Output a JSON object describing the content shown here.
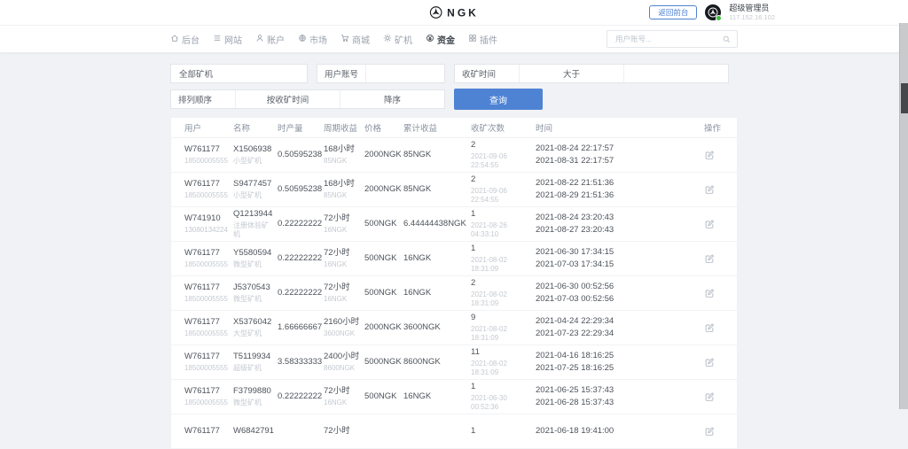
{
  "header": {
    "logo_text": "NGK",
    "back_button_label": "返回前台",
    "admin_name": "超级管理员",
    "admin_ip": "117.152.16.102"
  },
  "nav": {
    "items": [
      {
        "label": "后台",
        "icon": "home"
      },
      {
        "label": "网站",
        "icon": "list"
      },
      {
        "label": "账户",
        "icon": "user"
      },
      {
        "label": "市场",
        "icon": "globe"
      },
      {
        "label": "商城",
        "icon": "cart"
      },
      {
        "label": "矿机",
        "icon": "gear"
      },
      {
        "label": "资金",
        "icon": "coin"
      },
      {
        "label": "插件",
        "icon": "grid"
      }
    ],
    "active_item": "资金",
    "search_placeholder": "用户账号..."
  },
  "filters": {
    "miner_type": "全部矿机",
    "account_label": "用户账号",
    "account_value": "",
    "mine_time_label": "收矿时间",
    "mine_time_operator": "大于",
    "mine_time_value": "",
    "sort_label": "排列顺序",
    "sort_field": "按收矿时间",
    "sort_order": "降序",
    "query_button_label": "查询"
  },
  "table": {
    "columns": [
      "用户",
      "名称",
      "时产量",
      "周期收益",
      "价格",
      "累计收益",
      "收矿次数",
      "时间",
      "操作"
    ],
    "rows": [
      {
        "user": "W761177",
        "phone": "18500005555",
        "name": "X1506938",
        "type": "小型矿机",
        "hourly": "0.50595238",
        "cycle": "168小时",
        "cycle_income": "85NGK",
        "price": "2000NGK",
        "total": "85NGK",
        "count": "2",
        "count_time": "2021-09-06 22:54:55",
        "time_start": "2021-08-24 22:17:57",
        "time_end": "2021-08-31 22:17:57"
      },
      {
        "user": "W761177",
        "phone": "18500005555",
        "name": "S9477457",
        "type": "小型矿机",
        "hourly": "0.50595238",
        "cycle": "168小时",
        "cycle_income": "85NGK",
        "price": "2000NGK",
        "total": "85NGK",
        "count": "2",
        "count_time": "2021-09-06 22:54:55",
        "time_start": "2021-08-22 21:51:36",
        "time_end": "2021-08-29 21:51:36"
      },
      {
        "user": "W741910",
        "phone": "13080134224",
        "name": "Q1213944",
        "type": "注册体验矿机",
        "hourly": "0.22222222",
        "cycle": "72小时",
        "cycle_income": "16NGK",
        "price": "500NGK",
        "total": "6.44444438NGK",
        "count": "1",
        "count_time": "2021-08-26 04:33:10",
        "time_start": "2021-08-24 23:20:43",
        "time_end": "2021-08-27 23:20:43"
      },
      {
        "user": "W761177",
        "phone": "18500005555",
        "name": "Y5580594",
        "type": "微型矿机",
        "hourly": "0.22222222",
        "cycle": "72小时",
        "cycle_income": "16NGK",
        "price": "500NGK",
        "total": "16NGK",
        "count": "1",
        "count_time": "2021-08-02 18:31:09",
        "time_start": "2021-06-30 17:34:15",
        "time_end": "2021-07-03 17:34:15"
      },
      {
        "user": "W761177",
        "phone": "18500005555",
        "name": "J5370543",
        "type": "微型矿机",
        "hourly": "0.22222222",
        "cycle": "72小时",
        "cycle_income": "16NGK",
        "price": "500NGK",
        "total": "16NGK",
        "count": "2",
        "count_time": "2021-08-02 18:31:09",
        "time_start": "2021-06-30 00:52:56",
        "time_end": "2021-07-03 00:52:56"
      },
      {
        "user": "W761177",
        "phone": "18500005555",
        "name": "X5376042",
        "type": "大型矿机",
        "hourly": "1.66666667",
        "cycle": "2160小时",
        "cycle_income": "3600NGK",
        "price": "2000NGK",
        "total": "3600NGK",
        "count": "9",
        "count_time": "2021-08-02 18:31:09",
        "time_start": "2021-04-24 22:29:34",
        "time_end": "2021-07-23 22:29:34"
      },
      {
        "user": "W761177",
        "phone": "18500005555",
        "name": "T5119934",
        "type": "超级矿机",
        "hourly": "3.58333333",
        "cycle": "2400小时",
        "cycle_income": "8600NGK",
        "price": "5000NGK",
        "total": "8600NGK",
        "count": "11",
        "count_time": "2021-08-02 18:31:09",
        "time_start": "2021-04-16 18:16:25",
        "time_end": "2021-07-25 18:16:25"
      },
      {
        "user": "W761177",
        "phone": "18500005555",
        "name": "F3799880",
        "type": "微型矿机",
        "hourly": "0.22222222",
        "cycle": "72小时",
        "cycle_income": "16NGK",
        "price": "500NGK",
        "total": "16NGK",
        "count": "1",
        "count_time": "2021-06-30 00:52:36",
        "time_start": "2021-06-25 15:37:43",
        "time_end": "2021-06-28 15:37:43"
      },
      {
        "user": "W761177",
        "phone": "",
        "name": "W6842791",
        "type": "",
        "hourly": "",
        "cycle": "72小时",
        "cycle_income": "",
        "price": "",
        "total": "",
        "count": "1",
        "count_time": "",
        "time_start": "2021-06-18 19:41:00",
        "time_end": ""
      }
    ]
  },
  "colors": {
    "accent_blue": "#4e83d4",
    "online_green": "#3dbd3d",
    "scrollbar_thumb": "#454749"
  }
}
